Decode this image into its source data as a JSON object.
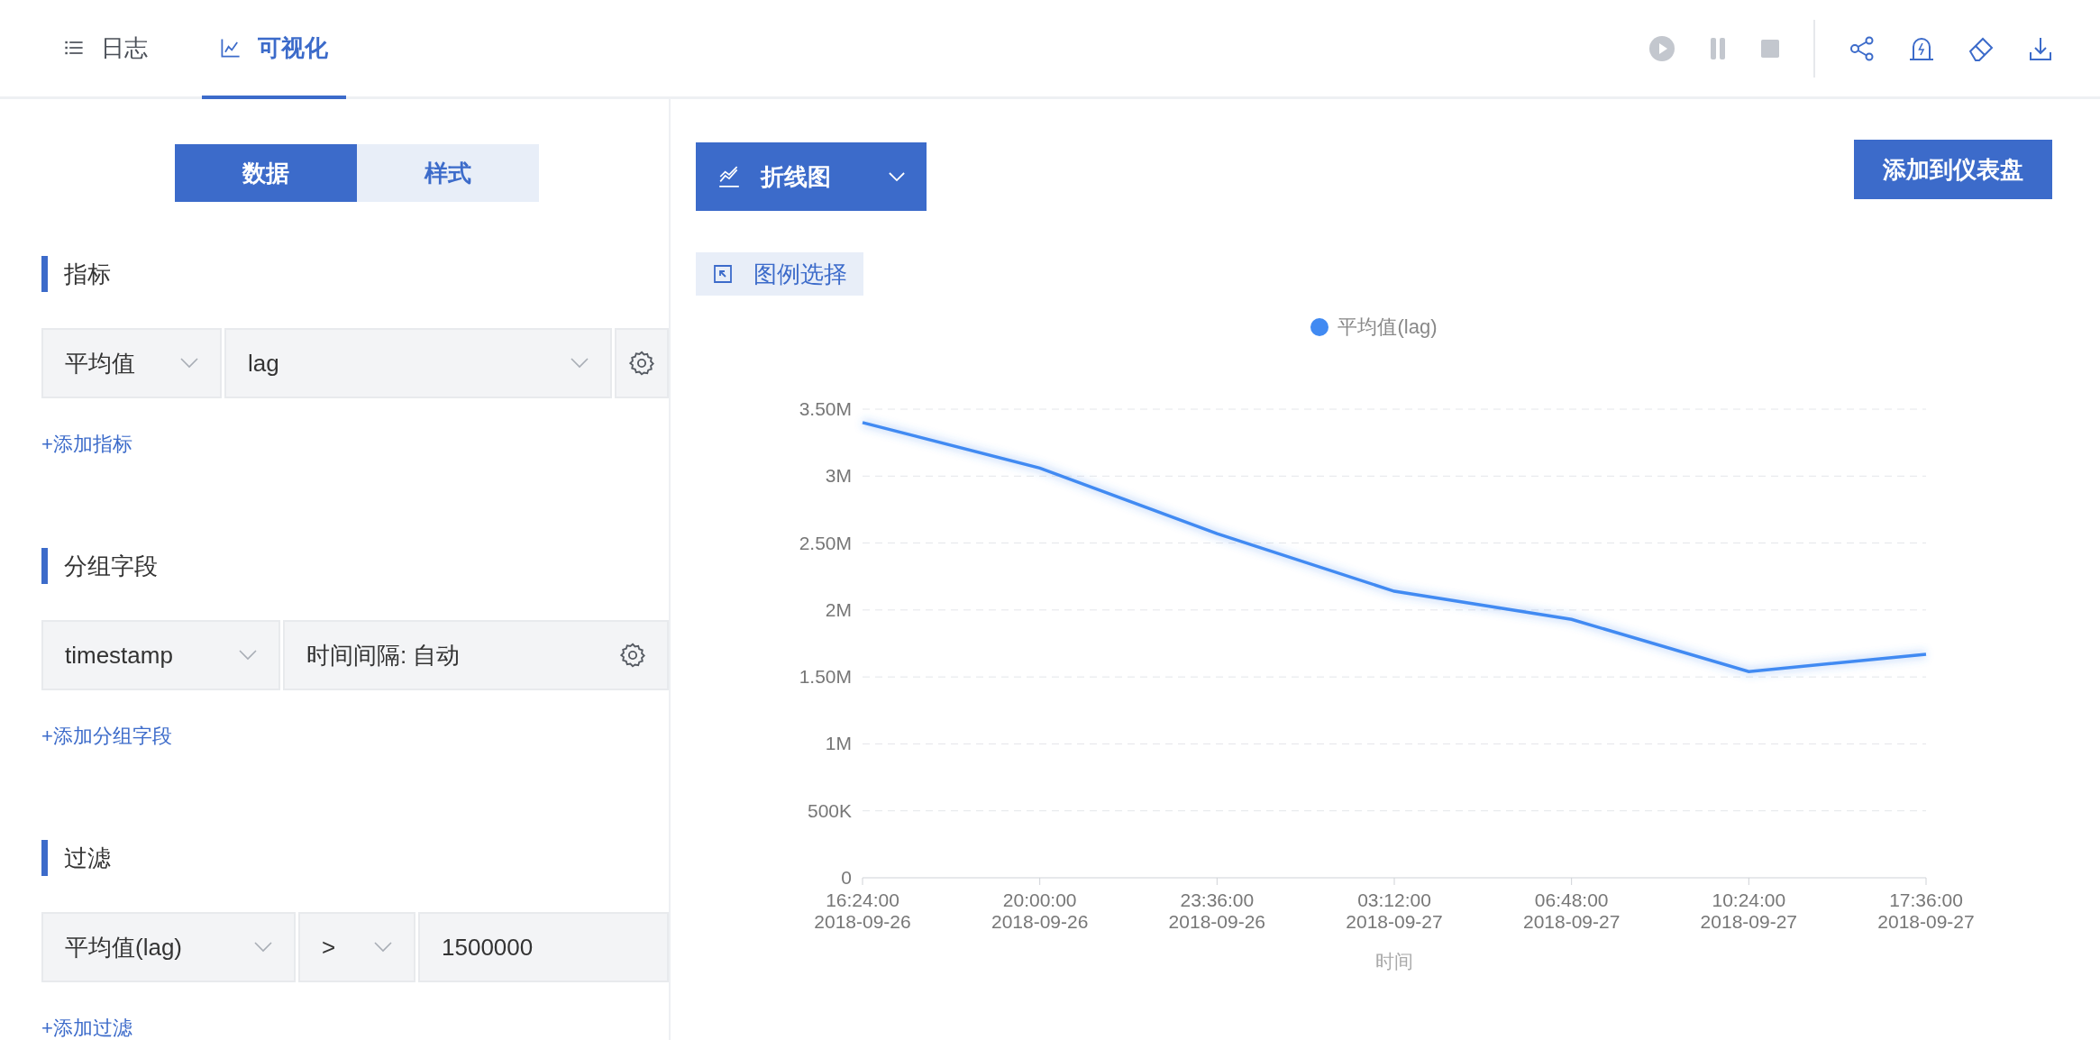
{
  "tabs": [
    {
      "label": "日志",
      "selected": false
    },
    {
      "label": "可视化",
      "selected": true
    }
  ],
  "panel_tabs": [
    {
      "label": "数据",
      "selected": true
    },
    {
      "label": "样式",
      "selected": false
    }
  ],
  "sections": [
    {
      "title": "指标",
      "fields": [
        {
          "kind": "select",
          "value": "平均值"
        },
        {
          "kind": "select",
          "value": "lag"
        },
        {
          "kind": "settings"
        }
      ],
      "add_link": "+添加指标"
    },
    {
      "title": "分组字段",
      "fields": [
        {
          "kind": "select",
          "value": "timestamp"
        },
        {
          "kind": "interval",
          "value": "时间间隔: 自动"
        }
      ],
      "add_link": "+添加分组字段"
    },
    {
      "title": "过滤",
      "fields": [
        {
          "kind": "select",
          "value": "平均值(lag)"
        },
        {
          "kind": "select",
          "value": ">"
        },
        {
          "kind": "input",
          "value": "1500000"
        }
      ],
      "add_link": "+添加过滤"
    }
  ],
  "chart_type": {
    "label": "折线图"
  },
  "add_button": "添加到仪表盘",
  "legend_select": "图例选择",
  "chart_data": {
    "type": "line",
    "xlabel": "时间",
    "grid": true,
    "categories": [
      "16:24:00 2018-09-26",
      "20:00:00 2018-09-26",
      "23:36:00 2018-09-26",
      "03:12:00 2018-09-27",
      "06:48:00 2018-09-27",
      "10:24:00 2018-09-27",
      "17:36:00 2018-09-27"
    ],
    "series": [
      {
        "name": "平均值(lag)",
        "color": "#418af2",
        "values": [
          3400000,
          3060000,
          2570000,
          2140000,
          1930000,
          1540000,
          1670000
        ]
      }
    ],
    "ylim": [
      0,
      3500000
    ],
    "yticks": [
      {
        "value": 0,
        "label": "0"
      },
      {
        "value": 500000,
        "label": "500K"
      },
      {
        "value": 1000000,
        "label": "1M"
      },
      {
        "value": 1500000,
        "label": "1.50M"
      },
      {
        "value": 2000000,
        "label": "2M"
      },
      {
        "value": 2500000,
        "label": "2.50M"
      },
      {
        "value": 3000000,
        "label": "3M"
      },
      {
        "value": 3500000,
        "label": "3.50M"
      }
    ]
  }
}
